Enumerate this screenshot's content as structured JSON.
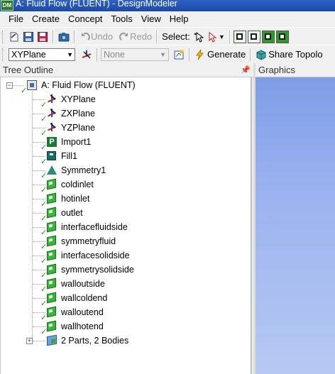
{
  "window": {
    "title": "A: Fluid Flow (FLUENT) - DesignModeler",
    "logo_text": "DM"
  },
  "menu": [
    "File",
    "Create",
    "Concept",
    "Tools",
    "View",
    "Help"
  ],
  "toolbar1": {
    "undo_label": "Undo",
    "redo_label": "Redo",
    "select_label": "Select:"
  },
  "toolbar2": {
    "plane_value": "XYPlane",
    "sketch_value": "None",
    "generate_label": "Generate",
    "share_label": "Share Topolo"
  },
  "tree": {
    "header": "Tree Outline",
    "root": "A: Fluid Flow (FLUENT)",
    "items": [
      {
        "label": "XYPlane",
        "icon": "plane-icon"
      },
      {
        "label": "ZXPlane",
        "icon": "plane-icon"
      },
      {
        "label": "YZPlane",
        "icon": "plane-icon"
      },
      {
        "label": "Import1",
        "icon": "import-icon"
      },
      {
        "label": "Fill1",
        "icon": "fill-icon"
      },
      {
        "label": "Symmetry1",
        "icon": "symmetry-icon"
      },
      {
        "label": "coldinlet",
        "icon": "named-selection-icon"
      },
      {
        "label": "hotinlet",
        "icon": "named-selection-icon"
      },
      {
        "label": "outlet",
        "icon": "named-selection-icon"
      },
      {
        "label": "interfacefluidside",
        "icon": "named-selection-icon"
      },
      {
        "label": "symmetryfluid",
        "icon": "named-selection-icon"
      },
      {
        "label": "interfacesolidside",
        "icon": "named-selection-icon"
      },
      {
        "label": "symmetrysolidside",
        "icon": "named-selection-icon"
      },
      {
        "label": "walloutside",
        "icon": "named-selection-icon"
      },
      {
        "label": "wallcoldend",
        "icon": "named-selection-icon"
      },
      {
        "label": "walloutend",
        "icon": "named-selection-icon"
      },
      {
        "label": "wallhotend",
        "icon": "named-selection-icon"
      }
    ],
    "parts": "2 Parts, 2 Bodies"
  },
  "graphics": {
    "header": "Graphics"
  },
  "colors": {
    "titlebar": "#1c49a8",
    "graphics_bg": "#9bb3ef",
    "check": "#1d9e1d"
  }
}
